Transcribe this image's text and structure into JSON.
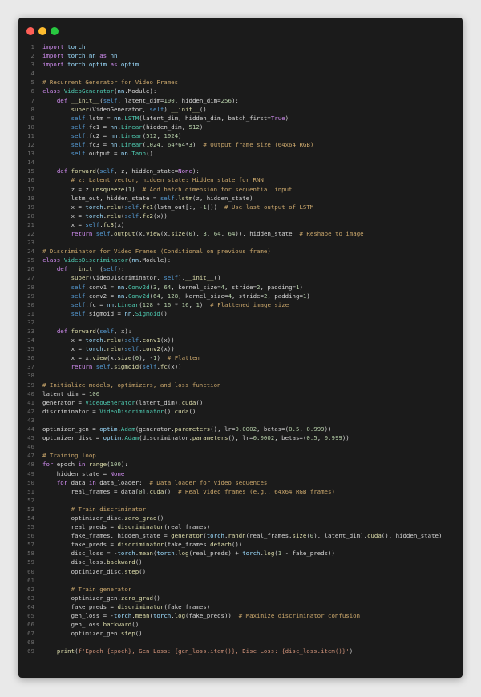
{
  "window": {
    "controls": [
      "close-dot",
      "minimize-dot",
      "maximize-dot"
    ],
    "colors": {
      "background": "#1b1b1b",
      "close": "#ff5f57",
      "minimize": "#febc2e",
      "maximize": "#28c840"
    }
  },
  "code": {
    "lines": [
      "import torch",
      "import torch.nn as nn",
      "import torch.optim as optim",
      "",
      "# Recurrent Generator for Video Frames",
      "class VideoGenerator(nn.Module):",
      "    def __init__(self, latent_dim=100, hidden_dim=256):",
      "        super(VideoGenerator, self).__init__()",
      "        self.lstm = nn.LSTM(latent_dim, hidden_dim, batch_first=True)",
      "        self.fc1 = nn.Linear(hidden_dim, 512)",
      "        self.fc2 = nn.Linear(512, 1024)",
      "        self.fc3 = nn.Linear(1024, 64*64*3)  # Output frame size (64x64 RGB)",
      "        self.output = nn.Tanh()",
      "",
      "    def forward(self, z, hidden_state=None):",
      "        # z: Latent vector, hidden_state: Hidden state for RNN",
      "        z = z.unsqueeze(1)  # Add batch dimension for sequential input",
      "        lstm_out, hidden_state = self.lstm(z, hidden_state)",
      "        x = torch.relu(self.fc1(lstm_out[:, -1]))  # Use last output of LSTM",
      "        x = torch.relu(self.fc2(x))",
      "        x = self.fc3(x)",
      "        return self.output(x.view(x.size(0), 3, 64, 64)), hidden_state  # Reshape to image",
      "",
      "# Discriminator for Video Frames (Conditional on previous frame)",
      "class VideoDiscriminator(nn.Module):",
      "    def __init__(self):",
      "        super(VideoDiscriminator, self).__init__()",
      "        self.conv1 = nn.Conv2d(3, 64, kernel_size=4, stride=2, padding=1)",
      "        self.conv2 = nn.Conv2d(64, 128, kernel_size=4, stride=2, padding=1)",
      "        self.fc = nn.Linear(128 * 16 * 16, 1)  # Flattened image size",
      "        self.sigmoid = nn.Sigmoid()",
      "",
      "    def forward(self, x):",
      "        x = torch.relu(self.conv1(x))",
      "        x = torch.relu(self.conv2(x))",
      "        x = x.view(x.size(0), -1)  # Flatten",
      "        return self.sigmoid(self.fc(x))",
      "",
      "# Initialize models, optimizers, and loss function",
      "latent_dim = 100",
      "generator = VideoGenerator(latent_dim).cuda()",
      "discriminator = VideoDiscriminator().cuda()",
      "",
      "optimizer_gen = optim.Adam(generator.parameters(), lr=0.0002, betas=(0.5, 0.999))",
      "optimizer_disc = optim.Adam(discriminator.parameters(), lr=0.0002, betas=(0.5, 0.999))",
      "",
      "# Training loop",
      "for epoch in range(100):",
      "    hidden_state = None",
      "    for data in data_loader:  # Data loader for video sequences",
      "        real_frames = data[0].cuda()  # Real video frames (e.g., 64x64 RGB frames)",
      "",
      "        # Train discriminator",
      "        optimizer_disc.zero_grad()",
      "        real_preds = discriminator(real_frames)",
      "        fake_frames, hidden_state = generator(torch.randn(real_frames.size(0), latent_dim).cuda(), hidden_state)",
      "        fake_preds = discriminator(fake_frames.detach())",
      "        disc_loss = -torch.mean(torch.log(real_preds) + torch.log(1 - fake_preds))",
      "        disc_loss.backward()",
      "        optimizer_disc.step()",
      "",
      "        # Train generator",
      "        optimizer_gen.zero_grad()",
      "        fake_preds = discriminator(fake_frames)",
      "        gen_loss = -torch.mean(torch.log(fake_preds))  # Maximize discriminator confusion",
      "        gen_loss.backward()",
      "        optimizer_gen.step()",
      "",
      "    print(f'Epoch {epoch}, Gen Loss: {gen_loss.item()}, Disc Loss: {disc_loss.item()}')"
    ]
  }
}
